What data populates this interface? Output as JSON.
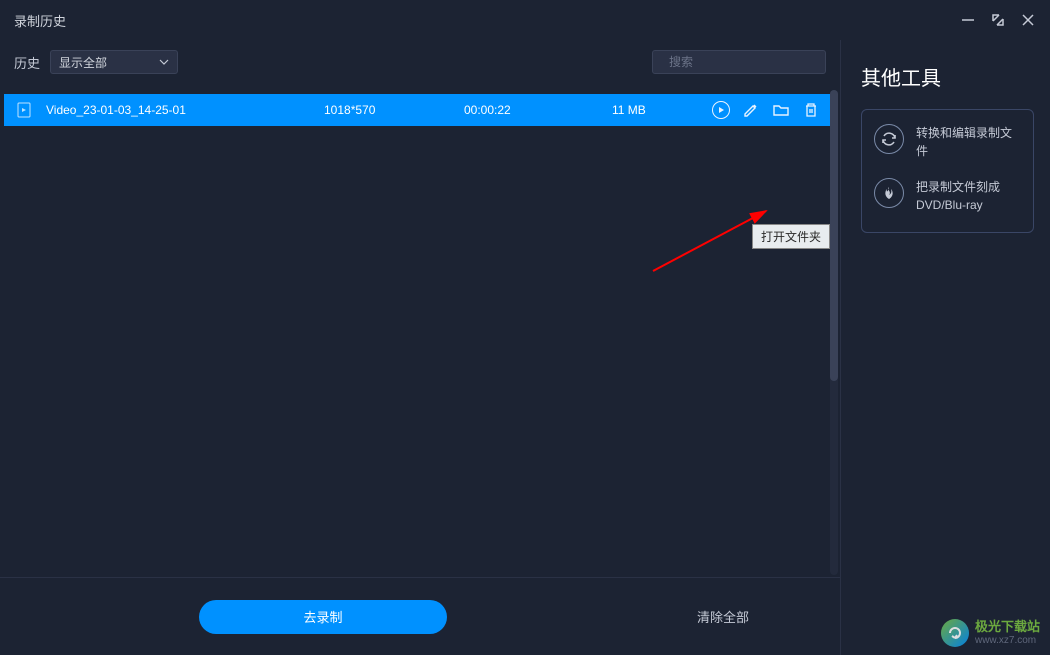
{
  "window": {
    "title": "录制历史"
  },
  "toolbar": {
    "history_label": "历史",
    "dropdown_value": "显示全部",
    "search_placeholder": "搜索"
  },
  "list": {
    "rows": [
      {
        "name": "Video_23-01-03_14-25-01",
        "resolution": "1018*570",
        "duration": "00:00:22",
        "size": "11 MB"
      }
    ]
  },
  "tooltip": {
    "text": "打开文件夹"
  },
  "footer": {
    "record_label": "去录制",
    "clear_label": "清除全部"
  },
  "side": {
    "title": "其他工具",
    "tools": [
      {
        "label": "转换和编辑录制文件"
      },
      {
        "label": "把录制文件刻成DVD/Blu-ray"
      }
    ]
  },
  "watermark": {
    "cn": "极光下载站",
    "en": "www.xz7.com"
  }
}
